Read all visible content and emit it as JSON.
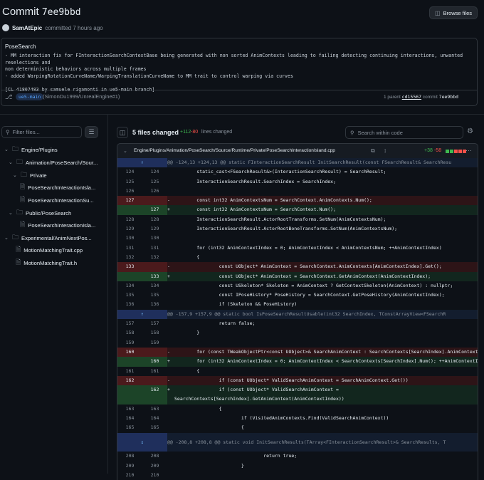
{
  "header": {
    "title_prefix": "Commit",
    "sha": "7ee9bbd",
    "browse_label": "Browse files",
    "author": "SamAtEpic",
    "committed_text": "committed 7 hours ago"
  },
  "message": {
    "title": "PoseSearch",
    "body": "- MM interaction fix for FInteractionSearchContextBase being generated with non sorted AnimContexts leading to failing detecting continuing interactions, unwanted reselections and\nnon deterministic behaviors across multiple frames\n- added WarpingRotationCurveName/WarpingTranslationCurveName to MM trait to control warping via curves\n\n[CL 41807483 by samuele rigamonti in ue5-main branch]",
    "branch": "ue5-main",
    "repo": "(SimonDu1999/UnrealEngine#1)",
    "parent_label": "1 parent",
    "parent_sha": "cd15567",
    "commit_label": "commit",
    "commit_sha": "7ee9bbd"
  },
  "sidebar": {
    "filter_placeholder": "Filter files...",
    "items": [
      {
        "label": "Engine/Plugins",
        "type": "folder"
      },
      {
        "label": "Animation/PoseSearch/Sour...",
        "type": "folder"
      },
      {
        "label": "Private",
        "type": "folder"
      },
      {
        "label": "PoseSearchInteractionIsla...",
        "type": "file"
      },
      {
        "label": "PoseSearchInteractionSu...",
        "type": "file"
      },
      {
        "label": "Public/PoseSearch",
        "type": "folder"
      },
      {
        "label": "PoseSearchInteractionIsla...",
        "type": "file"
      },
      {
        "label": "Experimental/AnimNextPos...",
        "type": "folder"
      },
      {
        "label": "MotionMatchingTrait.cpp",
        "type": "file"
      },
      {
        "label": "MotionMatchingTrait.h",
        "type": "file"
      }
    ]
  },
  "diff_toolbar": {
    "files_changed": "5 files changed",
    "additions": "+112",
    "deletions": "-80",
    "lines_changed": "lines changed",
    "search_placeholder": "Search within code"
  },
  "file": {
    "path": "Engine/Plugins/Animation/PoseSearch/Source/Runtime/Private/PoseSearchInteractionIsland.cpp",
    "additions": "+38",
    "deletions": "-58"
  },
  "diff_lines": [
    {
      "kind": "hunk",
      "n1": "",
      "n2": "",
      "sign": "",
      "code": "@@ -124,13 +124,13 @@ static FInteractionSearchResult InitSearchResult(const FSearchResult& SearchResu"
    },
    {
      "kind": "ctx",
      "n1": "124",
      "n2": "124",
      "sign": "",
      "code": "        static_cast<FSearchResult&>(InteractionSearchResult) = SearchResult;"
    },
    {
      "kind": "ctx",
      "n1": "125",
      "n2": "125",
      "sign": "",
      "code": "        InteractionSearchResult.SearchIndex = SearchIndex;"
    },
    {
      "kind": "ctx",
      "n1": "126",
      "n2": "126",
      "sign": "",
      "code": ""
    },
    {
      "kind": "del",
      "n1": "127",
      "n2": "",
      "sign": "-",
      "code": "        const int32 AnimContextsNum = SearchContext.AnimContexts.Num();"
    },
    {
      "kind": "add",
      "n1": "",
      "n2": "127",
      "sign": "+",
      "code": "        const int32 AnimContextsNum = SearchContext.Num();"
    },
    {
      "kind": "ctx",
      "n1": "128",
      "n2": "128",
      "sign": "",
      "code": "        InteractionSearchResult.ActorRootTransforms.SetNum(AnimContextsNum);"
    },
    {
      "kind": "ctx",
      "n1": "129",
      "n2": "129",
      "sign": "",
      "code": "        InteractionSearchResult.ActorRootBoneTransforms.SetNum(AnimContextsNum);"
    },
    {
      "kind": "ctx",
      "n1": "130",
      "n2": "130",
      "sign": "",
      "code": ""
    },
    {
      "kind": "ctx",
      "n1": "131",
      "n2": "131",
      "sign": "",
      "code": "        for (int32 AnimContextIndex = 0; AnimContextIndex < AnimContextsNum; ++AnimContextIndex)"
    },
    {
      "kind": "ctx",
      "n1": "132",
      "n2": "132",
      "sign": "",
      "code": "        {"
    },
    {
      "kind": "del",
      "n1": "133",
      "n2": "",
      "sign": "-",
      "code": "                const UObject* AnimContext = SearchContext.AnimContexts[AnimContextIndex].Get();"
    },
    {
      "kind": "add",
      "n1": "",
      "n2": "133",
      "sign": "+",
      "code": "                const UObject* AnimContext = SearchContext.GetAnimContext(AnimContextIndex);"
    },
    {
      "kind": "ctx",
      "n1": "134",
      "n2": "134",
      "sign": "",
      "code": "                const USkeleton* Skeleton = AnimContext ? GetContextSkeleton(AnimContext) : nullptr;"
    },
    {
      "kind": "ctx",
      "n1": "135",
      "n2": "135",
      "sign": "",
      "code": "                const IPoseHistory* PoseHistory = SearchContext.GetPoseHistory(AnimContextIndex);"
    },
    {
      "kind": "ctx",
      "n1": "136",
      "n2": "136",
      "sign": "",
      "code": "                if (Skeleton && PoseHistory)"
    },
    {
      "kind": "hunk",
      "n1": "",
      "n2": "",
      "sign": "",
      "code": "@@ -157,9 +157,9 @@ static bool IsPoseSearchResultUsable(int32 SearchIndex, TConstArrayView<FSearchR"
    },
    {
      "kind": "ctx",
      "n1": "157",
      "n2": "157",
      "sign": "",
      "code": "                return false;"
    },
    {
      "kind": "ctx",
      "n1": "158",
      "n2": "158",
      "sign": "",
      "code": "        }"
    },
    {
      "kind": "ctx",
      "n1": "159",
      "n2": "159",
      "sign": "",
      "code": ""
    },
    {
      "kind": "del",
      "n1": "160",
      "n2": "",
      "sign": "-",
      "code": "        for (const TWeakObjectPtr<const UObject>& SearchAnimContext : SearchContexts[SearchIndex].AnimContexts)"
    },
    {
      "kind": "add",
      "n1": "",
      "n2": "160",
      "sign": "+",
      "code": "        for (int32 AnimContextIndex = 0; AnimContextIndex < SearchContexts[SearchIndex].Num(); ++AnimContextIndex)"
    },
    {
      "kind": "ctx",
      "n1": "161",
      "n2": "161",
      "sign": "",
      "code": "        {"
    },
    {
      "kind": "del",
      "n1": "162",
      "n2": "",
      "sign": "-",
      "code": "                if (const UObject* ValidSearchAnimContext = SearchAnimContext.Get())"
    },
    {
      "kind": "add2",
      "n1": "",
      "n2": "162",
      "sign": "+",
      "code": "                if (const UObject* ValidSearchAnimContext =\nSearchContexts[SearchIndex].GetAnimContext(AnimContextIndex))"
    },
    {
      "kind": "ctx",
      "n1": "163",
      "n2": "163",
      "sign": "",
      "code": "                {"
    },
    {
      "kind": "ctx",
      "n1": "164",
      "n2": "164",
      "sign": "",
      "code": "                        if (VisitedAnimContexts.Find(ValidSearchAnimContext))"
    },
    {
      "kind": "ctx",
      "n1": "165",
      "n2": "165",
      "sign": "",
      "code": "                        {"
    },
    {
      "kind": "hunk2",
      "n1": "",
      "n2": "",
      "sign": "",
      "code": "@@ -208,8 +208,8 @@ static void InitSearchResults(TArray<FInteractionSearchResult>& SearchResults, T"
    },
    {
      "kind": "ctx",
      "n1": "208",
      "n2": "208",
      "sign": "",
      "code": "                                return true;"
    },
    {
      "kind": "ctx",
      "n1": "209",
      "n2": "209",
      "sign": "",
      "code": "                        }"
    },
    {
      "kind": "ctx",
      "n1": "210",
      "n2": "210",
      "sign": "",
      "code": ""
    }
  ],
  "colors": {
    "background": "#0d1117",
    "addition": "#3fb950",
    "deletion": "#f85149",
    "link": "#58a6ff"
  }
}
